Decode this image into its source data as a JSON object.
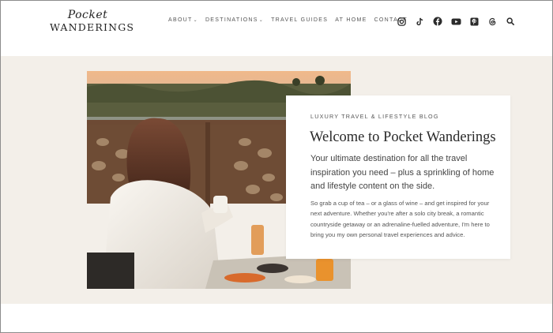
{
  "logo": {
    "script": "Pocket",
    "caps": "WANDERINGS"
  },
  "nav": {
    "items": [
      {
        "label": "ABOUT",
        "dropdown": true
      },
      {
        "label": "DESTINATIONS",
        "dropdown": true
      },
      {
        "label": "TRAVEL GUIDES",
        "dropdown": false
      },
      {
        "label": "AT HOME",
        "dropdown": false
      },
      {
        "label": "CONTACT",
        "dropdown": false
      }
    ],
    "chevron": "⌄"
  },
  "social": [
    "instagram-icon",
    "tiktok-icon",
    "facebook-icon",
    "youtube-icon",
    "pinterest-icon",
    "threads-icon",
    "search-icon"
  ],
  "hero": {
    "eyebrow": "LUXURY TRAVEL & LIFESTYLE BLOG",
    "title": "Welcome to Pocket Wanderings",
    "lead": "Your ultimate destination for all the travel inspiration you need – plus a sprinkling of home and lifestyle content on the side.",
    "body": "So grab a cup of tea – or a glass of wine – and get inspired for your next adventure. Whether you're after a solo city break, a romantic countryside getaway or an adrenaline-fuelled adventure, I'm here to bring you my own personal travel experiences and advice."
  },
  "colors": {
    "background": "#f3efe9",
    "header": "#ffffff",
    "text": "#2a2a2a"
  }
}
